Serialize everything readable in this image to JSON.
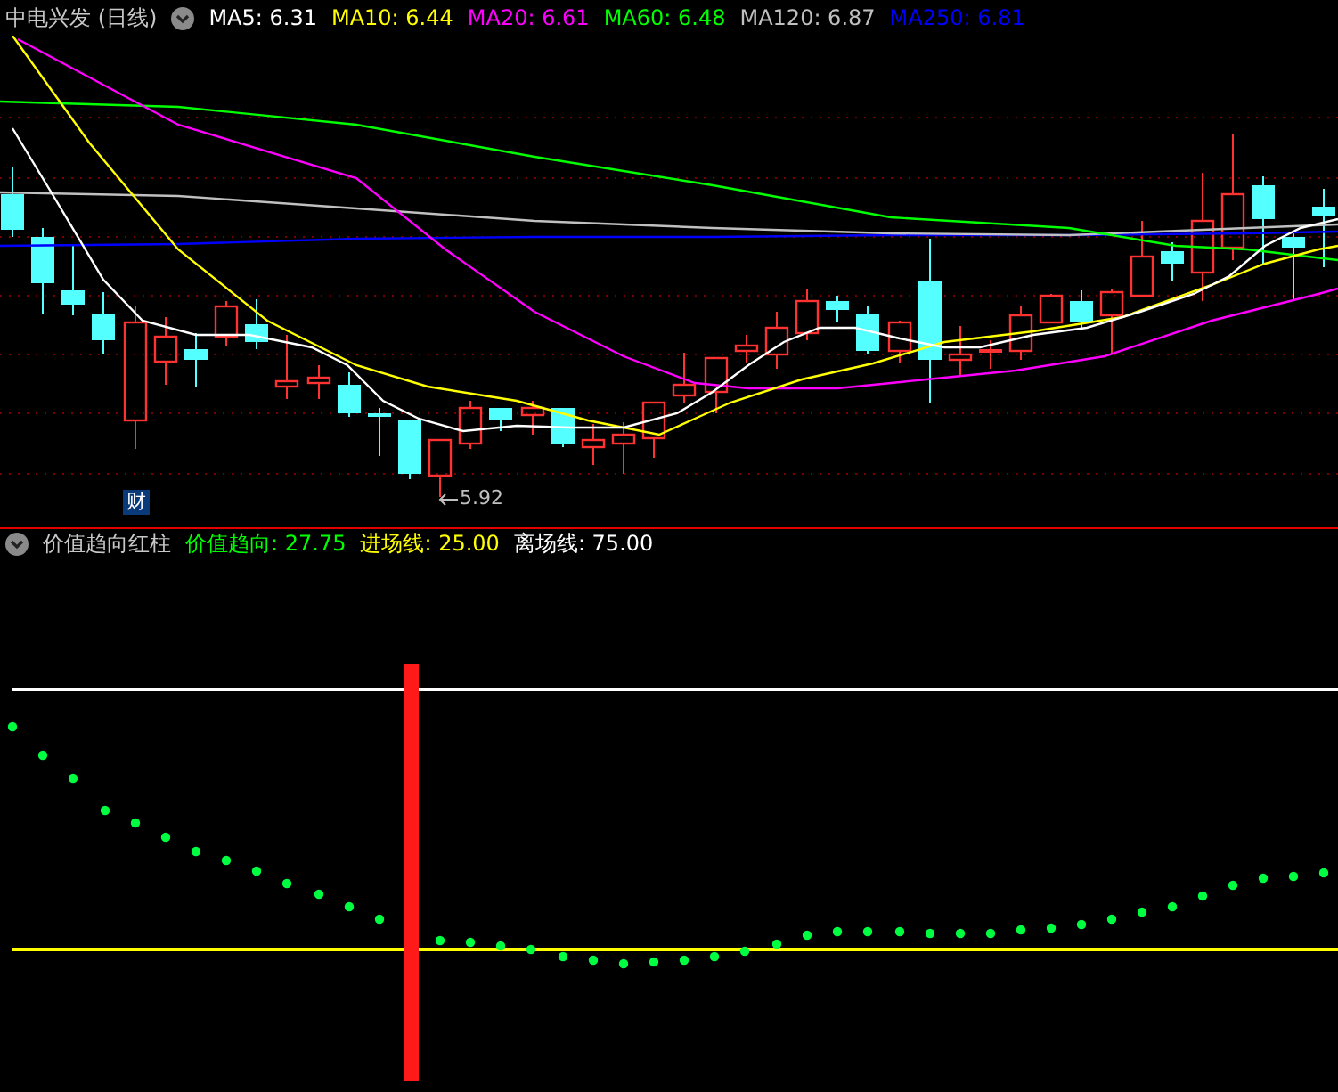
{
  "chart": {
    "title": "中电兴发 (日线)",
    "ma_labels": [
      {
        "text": "MA5: 6.31",
        "color": "#ffffff"
      },
      {
        "text": "MA10: 6.44",
        "color": "#ffff00"
      },
      {
        "text": "MA20: 6.61",
        "color": "#ff00ff"
      },
      {
        "text": "MA60: 6.48",
        "color": "#00ff00"
      },
      {
        "text": "MA120: 6.87",
        "color": "#c0c0c0"
      },
      {
        "text": "MA250: 6.81",
        "color": "#0000ff"
      }
    ],
    "low_marker": "5.92",
    "finance_badge": "财"
  },
  "indicator": {
    "name": "价值趋向红柱",
    "values": [
      {
        "text": "价值趋向: 27.75",
        "color": "#00ff00"
      },
      {
        "text": "进场线: 25.00",
        "color": "#ffff00"
      },
      {
        "text": "离场线: 75.00",
        "color": "#ffffff"
      }
    ]
  }
}
